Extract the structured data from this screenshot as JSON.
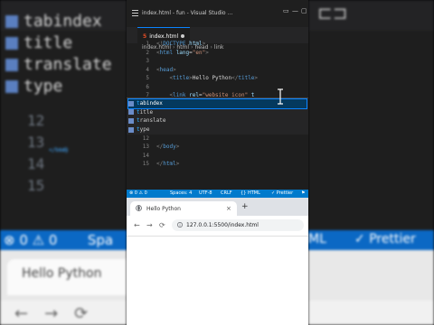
{
  "background": {
    "suggest_words": [
      "tabindex",
      "title",
      "translate",
      "type"
    ],
    "line_numbers": [
      "12",
      "13",
      "14",
      "15"
    ],
    "close_body": "</body",
    "close_html": "</html",
    "status_left": "⊗ 0 ⚠ 0",
    "status_frag": "Spa",
    "status_right_frag": "ML",
    "status_prettier": "Prettier",
    "browser_tab_title": "Hello Python"
  },
  "titlebar": {
    "title": "index.html - fun - Visual Studio ..."
  },
  "editor": {
    "tab_label": "index.html",
    "tab_icon": "html5-icon",
    "breadcrumb": [
      "index.html",
      "html",
      "head",
      "link"
    ],
    "lines": [
      {
        "num": "1",
        "parts": [
          [
            "br",
            "<!"
          ],
          [
            "tag",
            "DOCTYPE"
          ],
          [
            "attr",
            " html"
          ],
          [
            "br",
            ">"
          ]
        ]
      },
      {
        "num": "2",
        "parts": [
          [
            "br",
            "<"
          ],
          [
            "tag",
            "html"
          ],
          [
            "attr",
            " lang"
          ],
          [
            "txt",
            "="
          ],
          [
            "str",
            "\"en\""
          ],
          [
            "br",
            ">"
          ]
        ]
      },
      {
        "num": "3",
        "parts": []
      },
      {
        "num": "4",
        "parts": [
          [
            "br",
            "<"
          ],
          [
            "tag",
            "head"
          ],
          [
            "br",
            ">"
          ]
        ]
      },
      {
        "num": "5",
        "parts": [
          [
            "txt",
            "    "
          ],
          [
            "br",
            "<"
          ],
          [
            "tag",
            "title"
          ],
          [
            "br",
            ">"
          ],
          [
            "txt",
            "Hello Python"
          ],
          [
            "br",
            "</"
          ],
          [
            "tag",
            "title"
          ],
          [
            "br",
            ">"
          ]
        ]
      },
      {
        "num": "6",
        "parts": []
      },
      {
        "num": "7",
        "parts": [
          [
            "txt",
            "    "
          ],
          [
            "br",
            "<"
          ],
          [
            "tag",
            "link"
          ],
          [
            "attr",
            " rel"
          ],
          [
            "txt",
            "="
          ],
          [
            "str",
            "\"website icon\""
          ],
          [
            "attr",
            " t"
          ]
        ]
      },
      {
        "num": "12",
        "parts": []
      },
      {
        "num": "13",
        "parts": [
          [
            "br",
            "</"
          ],
          [
            "tag",
            "body"
          ],
          [
            "br",
            ">"
          ]
        ]
      },
      {
        "num": "14",
        "parts": []
      },
      {
        "num": "15",
        "parts": [
          [
            "br",
            "</"
          ],
          [
            "tag",
            "html"
          ],
          [
            "br",
            ">"
          ]
        ]
      }
    ],
    "suggestions": [
      {
        "prefix": "t",
        "rest": "abindex",
        "selected": true
      },
      {
        "prefix": "t",
        "rest": "itle",
        "selected": false
      },
      {
        "prefix": "t",
        "rest": "ranslate",
        "selected": false
      },
      {
        "prefix": "t",
        "rest": "ype",
        "selected": false
      }
    ]
  },
  "statusbar": {
    "errors": "⊗ 0 ⚠ 0",
    "spaces": "Spaces: 4",
    "encoding": "UTF-8",
    "eol": "CRLF",
    "language": "{} HTML",
    "prettier": "✓ Prettier",
    "bg_color": "#007acc"
  },
  "browser": {
    "tab_title": "Hello Python",
    "url": "127.0.0.1:5500/index.html",
    "new_tab": "+",
    "close": "×"
  }
}
